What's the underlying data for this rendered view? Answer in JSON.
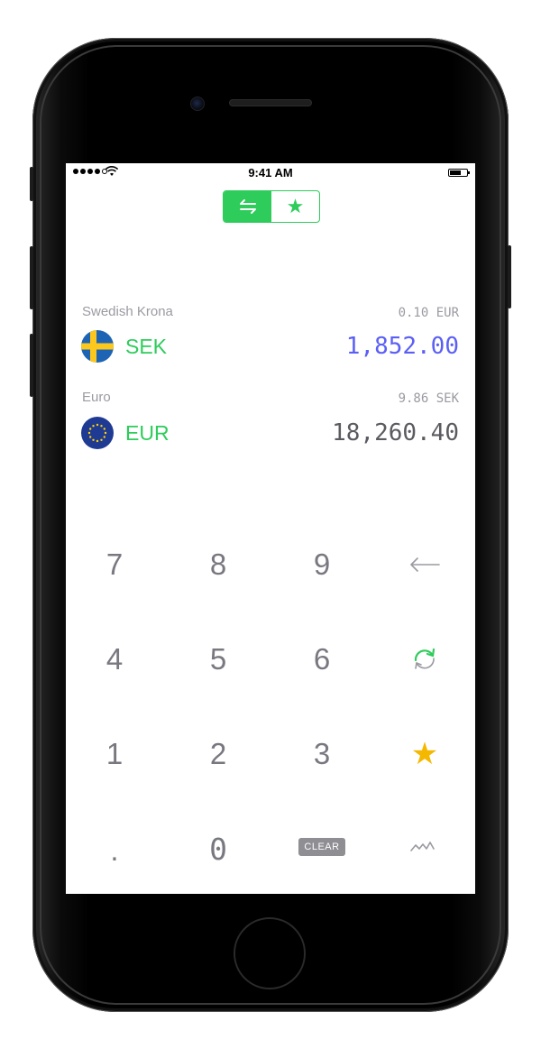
{
  "status_bar": {
    "time": "9:41 AM"
  },
  "mode_toggle": {
    "convert_icon": "swap-arrows-icon",
    "favorites_icon": "star-icon"
  },
  "currencies": [
    {
      "name": "Swedish Krona",
      "code": "SEK",
      "rate": "0.10 EUR",
      "amount": "1,852.00",
      "amount_color": "#5b5ff5",
      "flag": "sweden-flag-icon"
    },
    {
      "name": "Euro",
      "code": "EUR",
      "rate": "9.86 SEK",
      "amount": "18,260.40",
      "amount_color": "#5a5a60",
      "flag": "eu-flag-icon"
    }
  ],
  "keypad": {
    "row1": [
      "7",
      "8",
      "9"
    ],
    "row2": [
      "4",
      "5",
      "6"
    ],
    "row3": [
      "1",
      "2",
      "3"
    ],
    "dot": ".",
    "zero": "0",
    "clear": "CLEAR",
    "backspace_icon": "backspace-arrow-icon",
    "swap_icon": "refresh-swap-icon",
    "favorite_icon": "star-icon",
    "chart_icon": "chart-line-icon"
  },
  "colors": {
    "accent": "#2ecc5b",
    "star": "#f5b800",
    "input_amount": "#5b5ff5"
  }
}
